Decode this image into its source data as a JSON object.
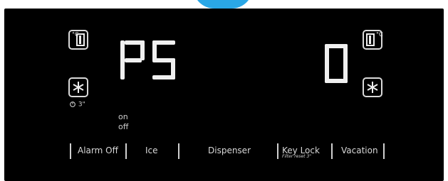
{
  "display": {
    "left_code": "P5",
    "right_value": "0",
    "units": {
      "left_deg": "°C",
      "right_deg": "°C"
    },
    "left_small_label": "3\"",
    "status": {
      "on": "on",
      "off": "off"
    }
  },
  "menu": {
    "alarm_off": "Alarm Off",
    "ice": "Ice",
    "dispenser": "Dispenser",
    "key_lock": "Key Lock",
    "filter_reset": "Filter reset 3\"",
    "vacation": "Vacation"
  },
  "icons": {
    "fridge_left": "fridge-icon",
    "freezer_left": "snowflake-icon",
    "fridge_right": "fridge-icon",
    "freezer_right": "snowflake-icon"
  },
  "colors": {
    "accent": "#2aa7e6",
    "panel": "#000000",
    "text": "#d8d8d8"
  }
}
